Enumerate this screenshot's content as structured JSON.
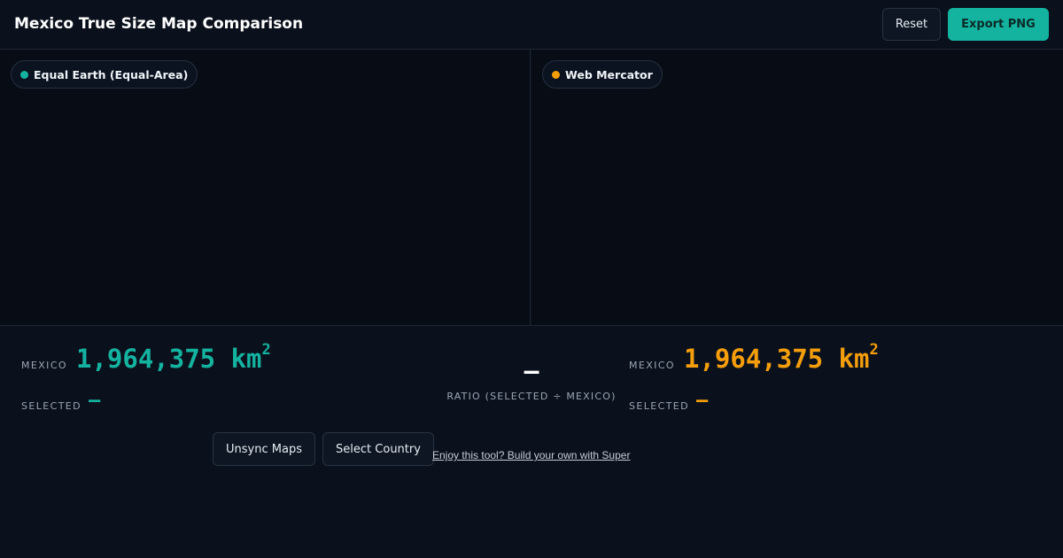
{
  "header": {
    "title": "Mexico True Size Map Comparison",
    "reset_label": "Reset",
    "export_label": "Export PNG"
  },
  "maps": {
    "left": {
      "label": "Equal Earth (Equal-Area)",
      "dot_color": "#14b3a0"
    },
    "right": {
      "label": "Web Mercator",
      "dot_color": "#f59e0b"
    }
  },
  "stats": {
    "left": {
      "base_label": "MEXICO",
      "base_value": "1,964,375 km",
      "unit_sup": "2",
      "selected_label": "SELECTED",
      "selected_value": "—"
    },
    "ratio": {
      "value": "—",
      "label": "RATIO (SELECTED ÷ MEXICO)"
    },
    "right": {
      "base_label": "MEXICO",
      "base_value": "1,964,375 km",
      "unit_sup": "2",
      "selected_label": "SELECTED",
      "selected_value": "—"
    }
  },
  "controls": {
    "sync_label": "Unsync Maps",
    "select_label": "Select Country"
  },
  "promo": {
    "text": "Enjoy this tool? Build your own with Super"
  },
  "colors": {
    "accent_teal": "#14b3a0",
    "accent_orange": "#f59e0b",
    "background": "#0b111c"
  }
}
